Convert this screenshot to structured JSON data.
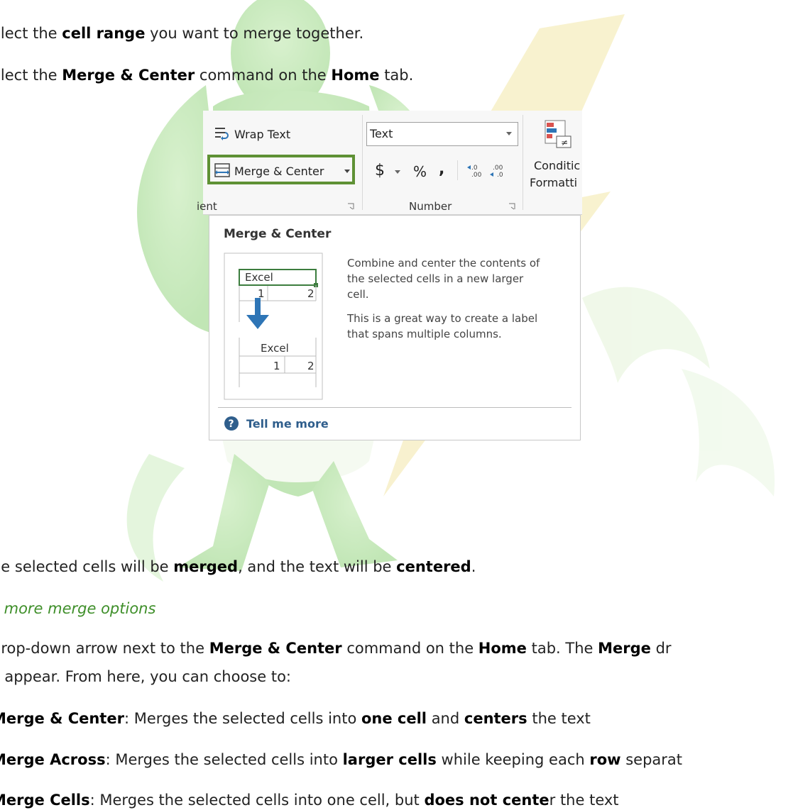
{
  "lines": {
    "step1": [
      {
        "t": "elect the ",
        "b": false
      },
      {
        "t": "cell range",
        "b": true
      },
      {
        "t": " you want to merge together.",
        "b": false
      }
    ],
    "step2": [
      {
        "t": "elect the ",
        "b": false
      },
      {
        "t": "Merge & Center",
        "b": true
      },
      {
        "t": " command on the ",
        "b": false
      },
      {
        "t": "Home",
        "b": true
      },
      {
        "t": " tab.",
        "b": false
      }
    ],
    "result": [
      {
        "t": "he selected cells will be ",
        "b": false
      },
      {
        "t": "merged",
        "b": true
      },
      {
        "t": ", and the text will be ",
        "b": false
      },
      {
        "t": "centered",
        "b": true
      },
      {
        "t": ".",
        "b": false
      }
    ],
    "subheading": "s more merge options",
    "para1": [
      {
        "t": "drop-down arrow next to the ",
        "b": false
      },
      {
        "t": "Merge & Center",
        "b": true
      },
      {
        "t": " command on the ",
        "b": false
      },
      {
        "t": "Home",
        "b": true
      },
      {
        "t": " tab. The ",
        "b": false
      },
      {
        "t": "Merge",
        "b": true
      },
      {
        "t": " dr",
        "b": false
      }
    ],
    "para2": [
      {
        "t": "ll appear. From here, you can choose to:",
        "b": false
      }
    ],
    "opt1": [
      {
        "t": "Merge & Center",
        "b": true
      },
      {
        "t": ": Merges the selected cells into ",
        "b": false
      },
      {
        "t": "one cell",
        "b": true
      },
      {
        "t": " and ",
        "b": false
      },
      {
        "t": "centers",
        "b": true
      },
      {
        "t": " the text",
        "b": false
      }
    ],
    "opt2": [
      {
        "t": "Merge Across",
        "b": true
      },
      {
        "t": ": Merges the selected cells into ",
        "b": false
      },
      {
        "t": "larger cells",
        "b": true
      },
      {
        "t": " while keeping each ",
        "b": false
      },
      {
        "t": "row",
        "b": true
      },
      {
        "t": " separat",
        "b": false
      }
    ],
    "opt3": [
      {
        "t": "Merge Cells",
        "b": true
      },
      {
        "t": ": Merges the selected cells into one cell, but ",
        "b": false
      },
      {
        "t": "does not cente",
        "b": true
      },
      {
        "t": "r the text",
        "b": false
      }
    ]
  },
  "ribbon": {
    "wrap_text": "Wrap Text",
    "merge_center": "Merge & Center",
    "number_format": "Text",
    "currency": "$",
    "percent": "%",
    "comma": ",",
    "conditional_line1": "Conditic",
    "conditional_line2": "Formatti",
    "alignment_group": "ient",
    "number_group": "Number"
  },
  "tooltip": {
    "title": "Merge & Center",
    "description1": "Combine and center the contents of\nthe selected cells in a new larger\ncell.",
    "description2": "This is a great way to create a label\nthat spans multiple columns.",
    "preview_before_text": "Excel",
    "preview_before_cells": [
      "1",
      "2"
    ],
    "preview_after_text": "Excel",
    "preview_after_cells": [
      "1",
      "2"
    ],
    "tell_me_more": "Tell me more"
  },
  "colors": {
    "accent_green": "#5f9135",
    "subheading_green": "#3f8f2a",
    "arrow_blue": "#2e75b6",
    "help_blue": "#2f5e8c"
  }
}
